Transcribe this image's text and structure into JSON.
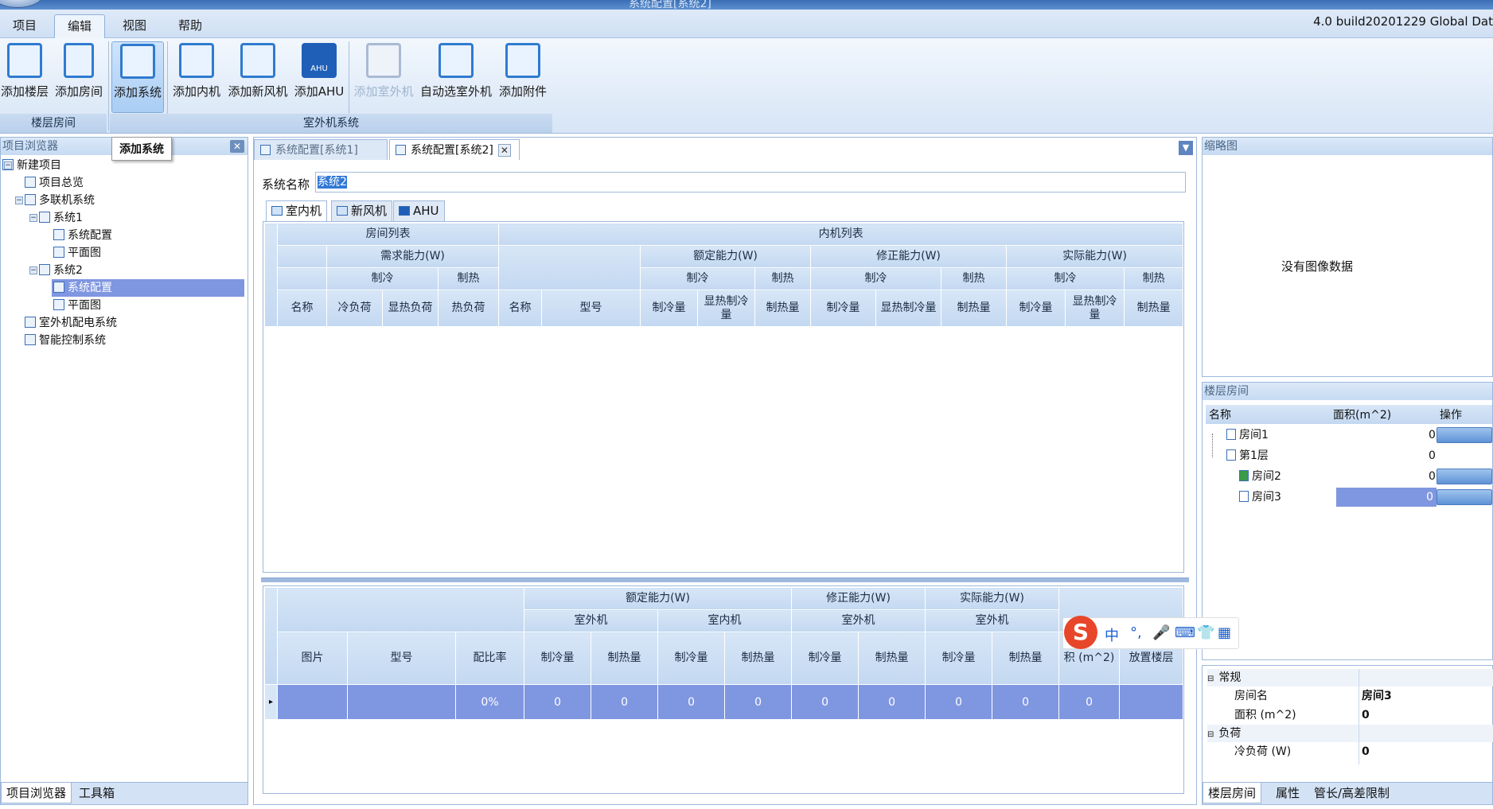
{
  "window": {
    "title": "系统配置[系统2]"
  },
  "menu": {
    "items": [
      "项目",
      "编辑",
      "视图",
      "帮助"
    ],
    "active": "编辑"
  },
  "build_info": "4.0 build20201229 Global Dat",
  "ribbon": {
    "buttons": {
      "add_floor": "添加楼层",
      "add_room": "添加房间",
      "add_system": "添加系统",
      "add_indoor": "添加内机",
      "add_fresh_air": "添加新风机",
      "add_ahu": "添加AHU",
      "add_outdoor": "添加室外机",
      "auto_outdoor": "自动选室外机",
      "add_accessory": "添加附件"
    },
    "groups": {
      "floor_room": "楼层房间",
      "outdoor_system": "室外机系统"
    },
    "ahu_icon_text": "AHU"
  },
  "tooltip": "添加系统",
  "left_panel": {
    "title": "项目浏览器",
    "tree": {
      "root": "新建项目",
      "overview": "项目总览",
      "vrf": "多联机系统",
      "sys1": "系统1",
      "sys1_config": "系统配置",
      "sys1_plan": "平面图",
      "sys2": "系统2",
      "sys2_config": "系统配置",
      "sys2_plan": "平面图",
      "power": "室外机配电系统",
      "control": "智能控制系统"
    },
    "tabs": [
      "项目浏览器",
      "工具箱"
    ]
  },
  "center": {
    "doc_tabs": [
      "系统配置[系统1]",
      "系统配置[系统2]"
    ],
    "name_label": "系统名称",
    "name_value": "系统2",
    "sub_tabs": [
      "室内机",
      "新风机",
      "AHU"
    ],
    "top_table": {
      "room_list": "房间列表",
      "indoor_list": "内机列表",
      "demand": "需求能力(W)",
      "rated": "额定能力(W)",
      "corrected": "修正能力(W)",
      "actual": "实际能力(W)",
      "cool": "制冷",
      "heat": "制热",
      "cols": {
        "name": "名称",
        "cool_load": "冷负荷",
        "sensible_load": "显热负荷",
        "heat_load": "热负荷",
        "name2": "名称",
        "model": "型号",
        "cool_cap": "制冷量",
        "sensible_cool": "显热制冷量",
        "heat_cap": "制热量"
      }
    },
    "bottom_table": {
      "rated": "额定能力(W)",
      "corrected": "修正能力(W)",
      "actual": "实际能力(W)",
      "outdoor": "室外机",
      "indoor": "室内机",
      "cols": {
        "picture": "图片",
        "model": "型号",
        "ratio": "配比率",
        "cool_cap": "制冷量",
        "heat_cap": "制热量",
        "area": "积 (m^2)",
        "floor": "放置楼层"
      },
      "row": {
        "ratio": "0%",
        "v1": "0",
        "v2": "0",
        "v3": "0",
        "v4": "0",
        "v5": "0",
        "v6": "0",
        "v7": "0",
        "v8": "0",
        "area": "0"
      }
    }
  },
  "thumbnail": {
    "title": "缩略图",
    "empty": "没有图像数据"
  },
  "floor_rooms": {
    "title": "楼层房间",
    "cols": {
      "name": "名称",
      "area": "面积(m^2)",
      "action": "操作"
    },
    "rows": [
      {
        "name": "房间1",
        "area": "0"
      },
      {
        "name": "第1层",
        "area": "0"
      },
      {
        "name": "房间2",
        "area": "0"
      },
      {
        "name": "房间3",
        "area": "0"
      }
    ]
  },
  "properties": {
    "general": "常规",
    "room_name_label": "房间名",
    "room_name": "房间3",
    "area_label": "面积 (m^2)",
    "area": "0",
    "load": "负荷",
    "cool_load_label": "冷负荷 (W)",
    "cool_load": "0"
  },
  "right_tabs": [
    "楼层房间",
    "属性",
    "管长/高差限制"
  ],
  "ime": {
    "logo": "S",
    "lang": "中",
    "punct": "°,"
  },
  "colors": {
    "selection": "#7f96e0",
    "header": "#c3d8f1",
    "accent": "#2f7bd0"
  }
}
